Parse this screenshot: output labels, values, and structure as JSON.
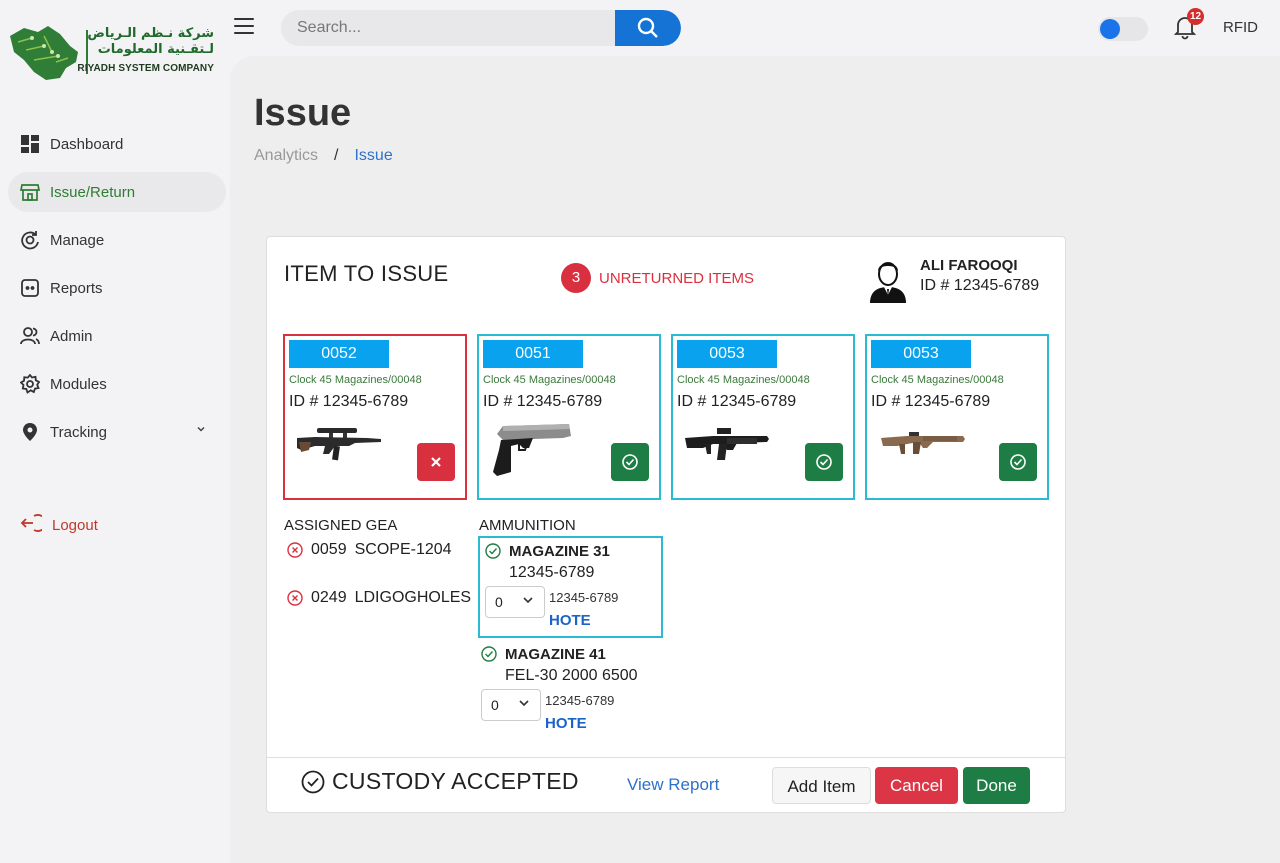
{
  "brand": {
    "arabic_line1": "شركة نـظم الـرياض",
    "arabic_line2": "لـتقـنية المعلومات",
    "english": "RIYADH SYSTEM COMPANY"
  },
  "sidebar": {
    "items": [
      {
        "label": "Dashboard",
        "icon": "dashboard-icon"
      },
      {
        "label": "Issue/Return",
        "icon": "store-icon",
        "active": true
      },
      {
        "label": "Manage",
        "icon": "manage-icon"
      },
      {
        "label": "Reports",
        "icon": "reports-icon"
      },
      {
        "label": "Admin",
        "icon": "users-icon"
      },
      {
        "label": "Modules",
        "icon": "gear-icon"
      },
      {
        "label": "Tracking",
        "icon": "location-pin-icon",
        "has_chevron": true
      }
    ],
    "logout_label": "Logout"
  },
  "topbar": {
    "search_placeholder": "Search...",
    "notification_count": "12",
    "rfid_label": "RFID",
    "toggle_on": true
  },
  "page": {
    "title": "Issue",
    "breadcrumb": [
      "Analytics",
      "Issue"
    ],
    "breadcrumb_separator": "/"
  },
  "card": {
    "title": "ITEM TO ISSUE",
    "unreturned_count": "3",
    "unreturned_label": "UNRETURNED ITEMS",
    "user_name": "ALI FAROOQI",
    "user_id": "ID # 12345-6789",
    "items": [
      {
        "code": "0052",
        "subtitle": "Clock 45 Magazines/00048",
        "id": "ID # 12345-6789",
        "status": "rejected",
        "gun": "scoped-rifle"
      },
      {
        "code": "0051",
        "subtitle": "Clock 45 Magazines/00048",
        "id": "ID # 12345-6789",
        "status": "accepted",
        "gun": "pistol"
      },
      {
        "code": "0053",
        "subtitle": "Clock 45 Magazines/00048",
        "id": "ID # 12345-6789",
        "status": "accepted",
        "gun": "carbine"
      },
      {
        "code": "0053",
        "subtitle": "Clock 45 Magazines/00048",
        "id": "ID # 12345-6789",
        "status": "accepted",
        "gun": "tan-rifle"
      }
    ],
    "assigned_gear": {
      "heading": "ASSIGNED GEA",
      "rows": [
        {
          "code": "0059",
          "name": "SCOPE-1204"
        },
        {
          "code": "0249",
          "name": "LDIGOGHOLES"
        }
      ]
    },
    "ammunition": {
      "heading": "AMMUNITION",
      "rows": [
        {
          "name": "MAGAZINE 31",
          "code": "12345-6789",
          "qty": "0",
          "sub": "12345-6789",
          "link": "HOTE",
          "highlighted": true
        },
        {
          "name": "MAGAZINE 41",
          "code": "FEL-30 2000 6500",
          "qty": "0",
          "sub": "12345-6789",
          "link": "HOTE",
          "highlighted": false
        }
      ]
    },
    "footer": {
      "custody_label": "CUSTODY ACCEPTED",
      "view_report": "View Report",
      "add_item": "Add Item",
      "cancel": "Cancel",
      "done": "Done"
    }
  },
  "colors": {
    "primary_blue": "#1673d6",
    "code_blue": "#08a2ee",
    "teal_border": "#2bbad3",
    "danger": "#d9303f",
    "success": "#1e7d45",
    "active_green": "#2e7d32"
  }
}
